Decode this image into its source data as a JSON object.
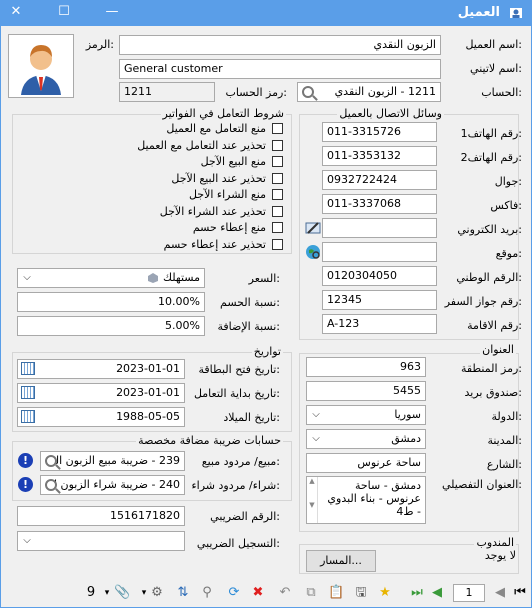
{
  "window": {
    "title": "العميل",
    "min": "—",
    "max": "☐",
    "close": "✕"
  },
  "customer": {
    "name_label": "اسم العميل:",
    "name": "الزبون النقدي",
    "latin_label": "اسم لاتيني:",
    "latin": "General customer",
    "code_label": "الرمز:",
    "account_label": "الحساب:",
    "account": "1211 - الزبون النقدي",
    "account_code_label": "رمز الحساب:",
    "account_code": "1211"
  },
  "contact": {
    "title": "وسائل الاتصال بالعميل",
    "phone1_label": "رقم الهاتف1:",
    "phone1": "011-3315726",
    "phone2_label": "رقم الهاتف2:",
    "phone2": "011-3353132",
    "mobile_label": "جوال:",
    "mobile": "0932722424",
    "fax_label": "فاكس:",
    "fax": "011-3337068",
    "email_label": "بريد الكتروني:",
    "email": "",
    "website_label": "موقع:",
    "website": "",
    "national_label": "الرقم الوطني:",
    "national": "0120304050",
    "passport_label": "رقم جواز السفر:",
    "passport": "12345",
    "residence_label": "رقم الاقامة:",
    "residence": "A-123"
  },
  "invoice_terms": {
    "title": "شروط التعامل في الفواتير",
    "items": [
      "منع التعامل مع العميل",
      "تحذير عند التعامل مع العميل",
      "منع البيع الآجل",
      "تحذير عند البيع الآجل",
      "منع الشراء الآجل",
      "تحذير عند الشراء الآجل",
      "منع إعطاء حسم",
      "تحذير عند إعطاء حسم"
    ]
  },
  "pricing": {
    "price_label": "السعر:",
    "price": "مستهلك",
    "discount_label": "نسبة الحسم:",
    "discount": "10.00%",
    "addition_label": "نسبة الإضافة:",
    "addition": "5.00%"
  },
  "dates": {
    "title": "تواريخ",
    "card_label": "تاريخ فتح البطاقة:",
    "card": "2023-01-01",
    "start_label": "تاريخ بداية التعامل:",
    "start": "2023-01-01",
    "birth_label": "تاريخ الميلاد:",
    "birth": "1988-05-05"
  },
  "vat": {
    "title": "حسابات ضريبة مضافة مخصصة",
    "sales_label": "مبيع/ مردود مبيع:",
    "sales": "239 - ضريبة مبيع الزبون الن",
    "purchase_label": "شراء/ مردود شراء:",
    "purchase": "240 - ضريبة شراء الزبون ال",
    "tax_no_label": "الرقم الضريبي:",
    "tax_no": "1516171820",
    "tax_reg_label": "التسجيل الضريبي:",
    "tax_reg": ""
  },
  "address": {
    "title": "العنوان",
    "area_label": "رمز المنطقة:",
    "area": "963",
    "pobox_label": "صندوق بريد:",
    "pobox": "5455",
    "country_label": "الدولة:",
    "country": "سوريا",
    "city_label": "المدينة:",
    "city": "دمشق",
    "street_label": "الشارع:",
    "street": "ساحة عرنوس",
    "detail_label": "العنوان التفصيلي:",
    "detail": "دمشق - ساحة عرنوس - بناء البدوي - ط4"
  },
  "delegate": {
    "title": "المندوب",
    "value": "لا يوجد",
    "route_button": "المسار..."
  },
  "toolbar": {
    "page": "1",
    "count": "9"
  },
  "colors": {
    "titlebar": "#5a9ee8"
  }
}
